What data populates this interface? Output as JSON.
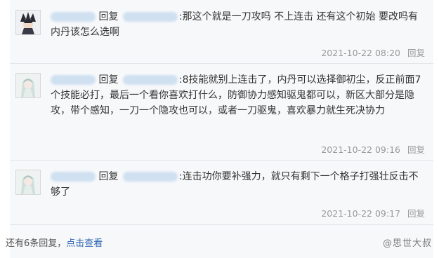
{
  "replies": [
    {
      "reply_word": "回复",
      "text": ":那这个就是一刀攻吗 不上连击 还有这个初始 要改吗有内丹该怎么选啊",
      "time": "2021-10-22 08:20",
      "reply_label": "回复"
    },
    {
      "reply_word": "回复",
      "text": ":8技能就别上连击了，内丹可以选择御初尘，反正前面7个技能必打，最后一个看你喜欢打什么，防御协力感知驱鬼都可以，新区大部分是隐攻，带个感知，一刀一个隐攻也可以，或者一刀驱鬼，喜欢暴力就生死决协力",
      "time": "2021-10-22 09:16",
      "reply_label": "回复"
    },
    {
      "reply_word": "回复",
      "text": ":连击功你要补强力，就只有剩下一个格子打强壮反击不够了",
      "time": "2021-10-22 09:17",
      "reply_label": "回复"
    }
  ],
  "footer": {
    "more_text": "还有6条回复，",
    "view_link": "点击查看"
  },
  "watermark": "@思世大叔"
}
